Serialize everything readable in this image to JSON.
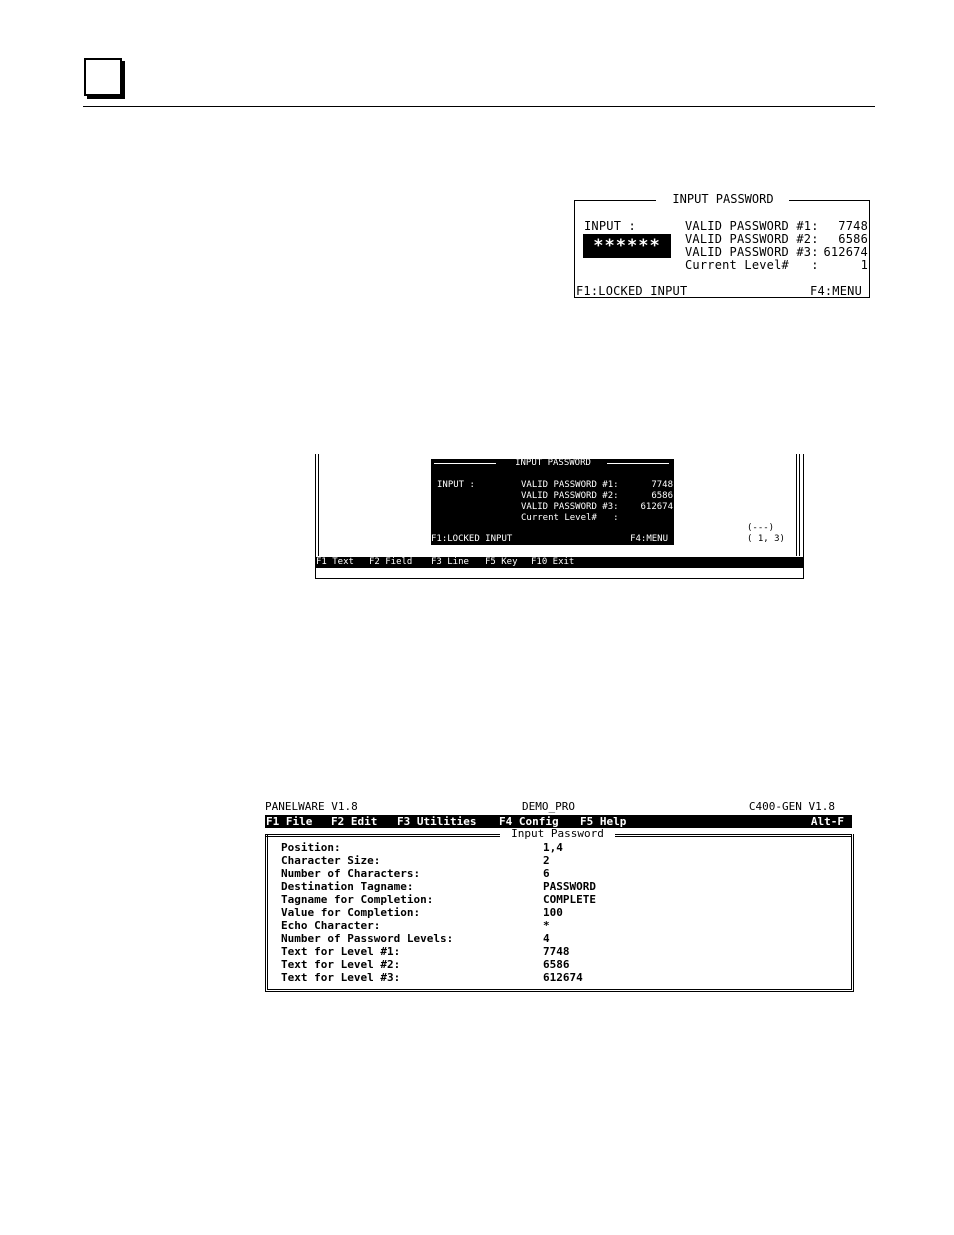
{
  "figure1": {
    "title": "INPUT PASSWORD",
    "input_label": "INPUT :",
    "masked_input": "******",
    "rows": [
      {
        "label": "VALID PASSWORD #1:",
        "value": "7748"
      },
      {
        "label": "VALID PASSWORD #2:",
        "value": "6586"
      },
      {
        "label": "VALID PASSWORD #3:",
        "value": "612674"
      },
      {
        "label": "Current Level#   :",
        "value": "1"
      }
    ],
    "f1_label": "F1:LOCKED INPUT",
    "f4_label": "F4:MENU"
  },
  "figure2": {
    "title": "INPUT PASSWORD",
    "input_label": "INPUT :",
    "rows": [
      {
        "label": "VALID PASSWORD #1:",
        "value": "7748"
      },
      {
        "label": "VALID PASSWORD #2:",
        "value": "6586"
      },
      {
        "label": "VALID PASSWORD #3:",
        "value": "612674"
      },
      {
        "label": "Current Level#   :",
        "value": ""
      }
    ],
    "f1_label": "F1:LOCKED INPUT",
    "f4_label": "F4:MENU",
    "cursor_status": "(---)",
    "cursor_position": "( 1, 3)",
    "menu": [
      "F1 Text",
      "F2 Field",
      "F3 Line",
      "F5 Key",
      "F10 Exit"
    ]
  },
  "figure3": {
    "app_title": "PANELWARE V1.8",
    "project_name": "DEMO_PRO",
    "target": "C400-GEN V1.8",
    "menu": [
      "F1 File",
      "F2 Edit",
      "F3 Utilities",
      "F4 Config",
      "F5 Help"
    ],
    "menu_right": "Alt-F",
    "dialog_title": "Input Password",
    "fields": [
      {
        "label": "Position:",
        "value": "1,4"
      },
      {
        "label": "Character Size:",
        "value": "2"
      },
      {
        "label": "Number of Characters:",
        "value": "6"
      },
      {
        "label": "Destination Tagname:",
        "value": "PASSWORD"
      },
      {
        "label": "Tagname for Completion:",
        "value": "COMPLETE"
      },
      {
        "label": "Value for Completion:",
        "value": "100"
      },
      {
        "label": "Echo Character:",
        "value": "*"
      },
      {
        "label": "Number of Password Levels:",
        "value": "4"
      },
      {
        "label": "Text for Level #1:",
        "value": "7748"
      },
      {
        "label": "Text for Level #2:",
        "value": "6586"
      },
      {
        "label": "Text for Level #3:",
        "value": "612674"
      }
    ]
  }
}
